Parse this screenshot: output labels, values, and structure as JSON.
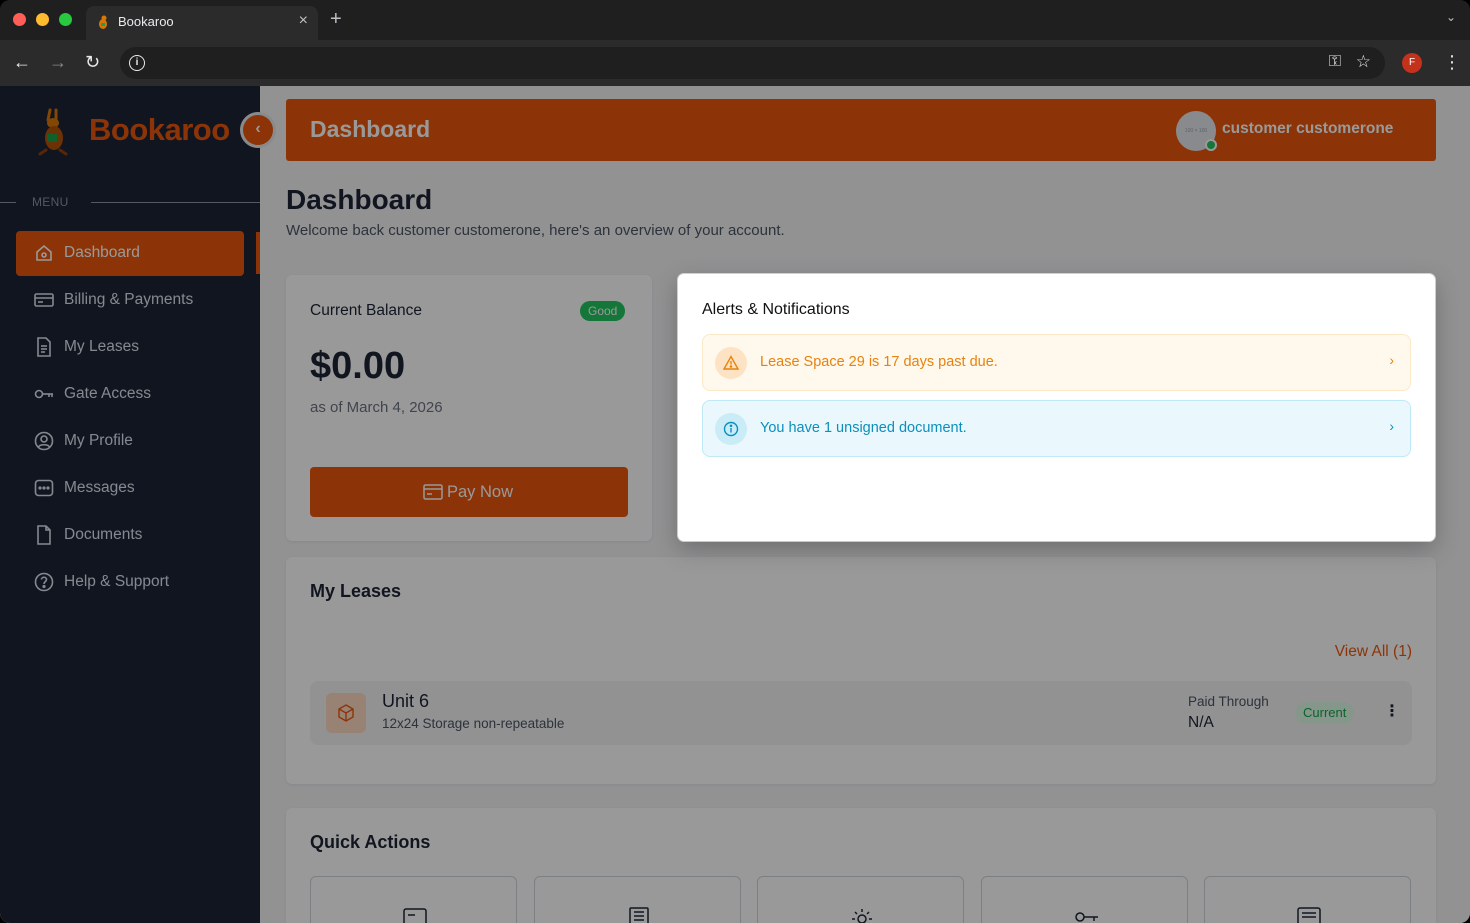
{
  "browser": {
    "tab_title": "Bookaroo",
    "profile_initial": "F"
  },
  "sidebar": {
    "logo_text": "Bookaroo",
    "menu_label": "MENU",
    "items": [
      {
        "label": "Dashboard",
        "icon": "home-icon",
        "active": true
      },
      {
        "label": "Billing & Payments",
        "icon": "credit-card-icon",
        "active": false
      },
      {
        "label": "My Leases",
        "icon": "document-list-icon",
        "active": false
      },
      {
        "label": "Gate Access",
        "icon": "key-icon",
        "active": false
      },
      {
        "label": "My Profile",
        "icon": "user-circle-icon",
        "active": false
      },
      {
        "label": "Messages",
        "icon": "chat-icon",
        "active": false
      },
      {
        "label": "Documents",
        "icon": "file-icon",
        "active": false
      },
      {
        "label": "Help & Support",
        "icon": "help-circle-icon",
        "active": false
      }
    ]
  },
  "header": {
    "title": "Dashboard",
    "avatar_placeholder": "100 × 100",
    "user_name": "customer customerone"
  },
  "page": {
    "title": "Dashboard",
    "subtitle": "Welcome back customer customerone, here's an overview of your account."
  },
  "balance": {
    "label": "Current Balance",
    "status": "Good",
    "amount": "$0.00",
    "as_of": "as of March 4, 2026",
    "pay_label": "Pay Now"
  },
  "alerts": {
    "title": "Alerts & Notifications",
    "items": [
      {
        "type": "warning",
        "text": "Lease Space 29 is 17 days past due.",
        "icon": "warning-triangle-icon"
      },
      {
        "type": "info",
        "text": "You have 1 unsigned document.",
        "icon": "info-circle-icon"
      }
    ]
  },
  "leases": {
    "title": "My Leases",
    "view_all": "View All (1)",
    "rows": [
      {
        "name": "Unit 6",
        "description": "12x24 Storage non-repeatable",
        "paid_through_label": "Paid Through",
        "paid_through": "N/A",
        "status": "Current"
      }
    ]
  },
  "quick_actions": {
    "title": "Quick Actions",
    "tiles": [
      "card-icon",
      "receipt-icon",
      "gear-icon",
      "key-icon",
      "message-icon"
    ]
  },
  "colors": {
    "brand": "#ea580c",
    "sidebar_bg": "#1c2434",
    "warning": "#e7830c",
    "info": "#0b8fbd",
    "success": "#22c55e"
  }
}
